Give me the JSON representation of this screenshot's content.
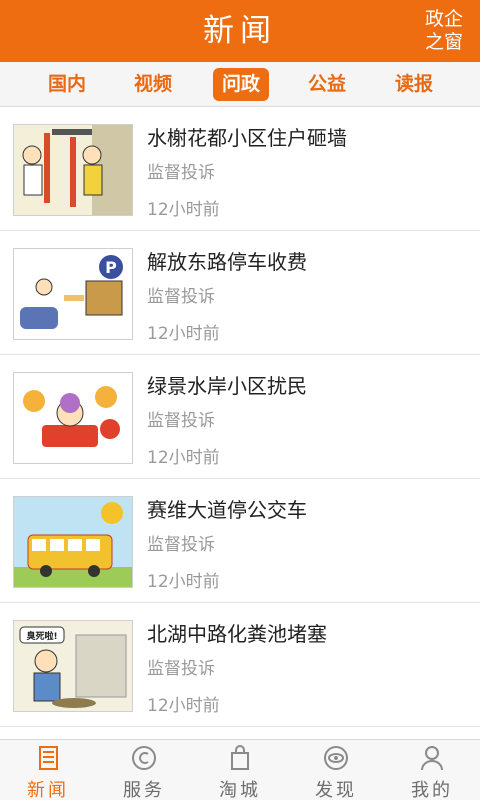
{
  "header": {
    "title": "新闻",
    "corner_line1": "政企",
    "corner_line2": "之窗"
  },
  "tabs": [
    {
      "label": "国内",
      "active": false
    },
    {
      "label": "视频",
      "active": false
    },
    {
      "label": "问政",
      "active": true
    },
    {
      "label": "公益",
      "active": false
    },
    {
      "label": "读报",
      "active": false
    }
  ],
  "news": [
    {
      "title": "水榭花都小区住户砸墙",
      "category": "监督投诉",
      "time": "12小时前"
    },
    {
      "title": "解放东路停车收费",
      "category": "监督投诉",
      "time": "12小时前"
    },
    {
      "title": "绿景水岸小区扰民",
      "category": "监督投诉",
      "time": "12小时前"
    },
    {
      "title": "赛维大道停公交车",
      "category": "监督投诉",
      "time": "12小时前"
    },
    {
      "title": "北湖中路化粪池堵塞",
      "category": "监督投诉",
      "time": "12小时前"
    }
  ],
  "thumb_texts": {
    "parking": "P",
    "speech": "臭死啦!"
  },
  "bottom_nav": [
    {
      "label": "新闻",
      "icon": "newspaper-icon",
      "active": true
    },
    {
      "label": "服务",
      "icon": "service-icon",
      "active": false
    },
    {
      "label": "淘城",
      "icon": "shopping-bag-icon",
      "active": false
    },
    {
      "label": "发现",
      "icon": "eye-icon",
      "active": false
    },
    {
      "label": "我的",
      "icon": "user-icon",
      "active": false
    }
  ],
  "colors": {
    "brand": "#ee6d10",
    "muted": "#9a9a9a"
  }
}
